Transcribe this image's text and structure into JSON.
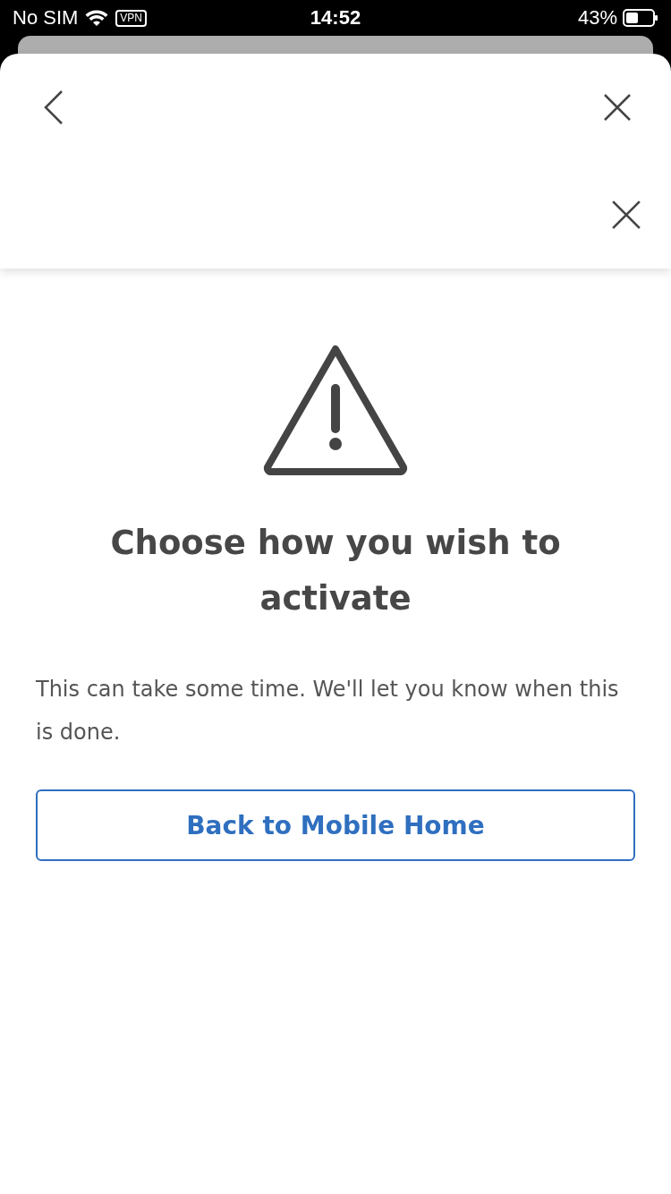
{
  "status_bar": {
    "carrier": "No SIM",
    "vpn": "VPN",
    "time": "14:52",
    "battery": "43%"
  },
  "header": {
    "actions": [
      {
        "kind": "close"
      },
      {
        "kind": "close"
      }
    ]
  },
  "message": {
    "title": "Choose how you wish to activate",
    "body": "This can take some time. We'll let you know when this is done."
  },
  "buttons": [
    {
      "label": "Back to Mobile Home"
    }
  ]
}
